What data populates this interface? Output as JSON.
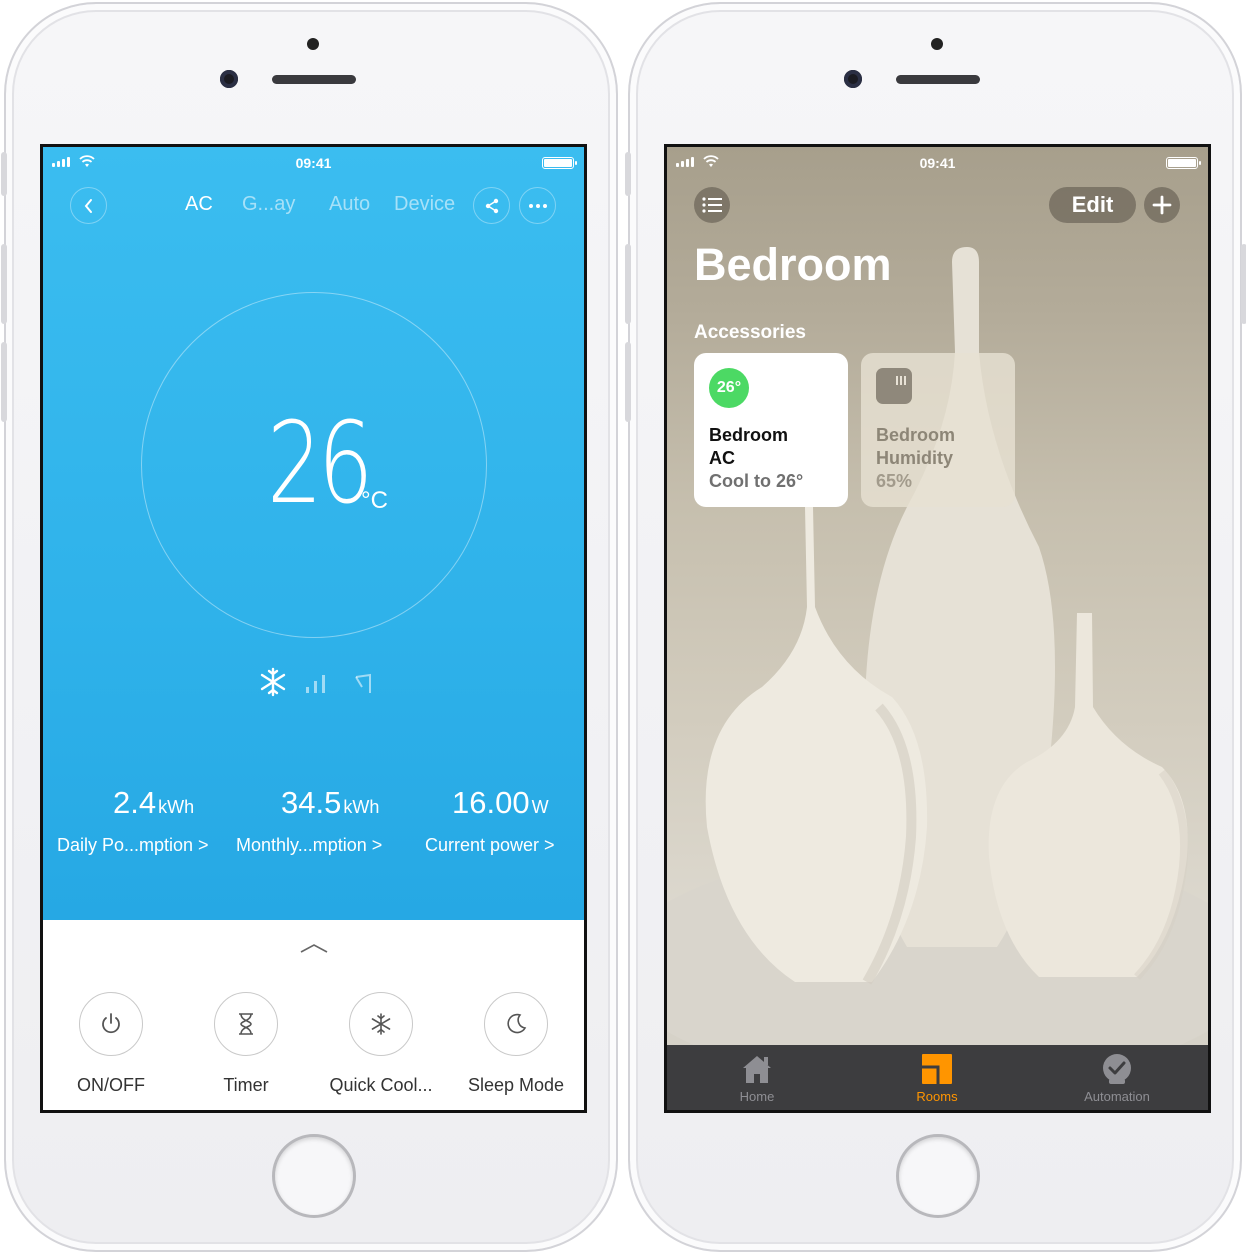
{
  "status_bar": {
    "time": "09:41"
  },
  "ac_app": {
    "nav": {
      "tabs": [
        "AC",
        "G...ay",
        "Auto",
        "Device"
      ]
    },
    "temperature": {
      "value": "26",
      "unit": "°C"
    },
    "stats": [
      {
        "value": "2.4",
        "unit": "kWh",
        "label": "Daily Po...mption >"
      },
      {
        "value": "34.5",
        "unit": "kWh",
        "label": "Monthly...mption >"
      },
      {
        "value": "16.00",
        "unit": "W",
        "label": "Current power >"
      }
    ],
    "controls": [
      {
        "label": "ON/OFF",
        "icon": "power-icon"
      },
      {
        "label": "Timer",
        "icon": "hourglass-icon"
      },
      {
        "label": "Quick Cool...",
        "icon": "snowflake-icon"
      },
      {
        "label": "Sleep Mode",
        "icon": "moon-icon"
      }
    ]
  },
  "home_app": {
    "header": {
      "edit_label": "Edit"
    },
    "room_title": "Bedroom",
    "section_title": "Accessories",
    "accessories": [
      {
        "badge": "26°",
        "name_line1": "Bedroom",
        "name_line2": "AC",
        "status": "Cool to 26°"
      },
      {
        "name_line1": "Bedroom",
        "name_line2": "Humidity",
        "status": "65%"
      }
    ],
    "tabs": [
      {
        "label": "Home"
      },
      {
        "label": "Rooms"
      },
      {
        "label": "Automation"
      }
    ],
    "colors": {
      "accent": "#ff9500",
      "active_badge": "#4cd964"
    }
  }
}
